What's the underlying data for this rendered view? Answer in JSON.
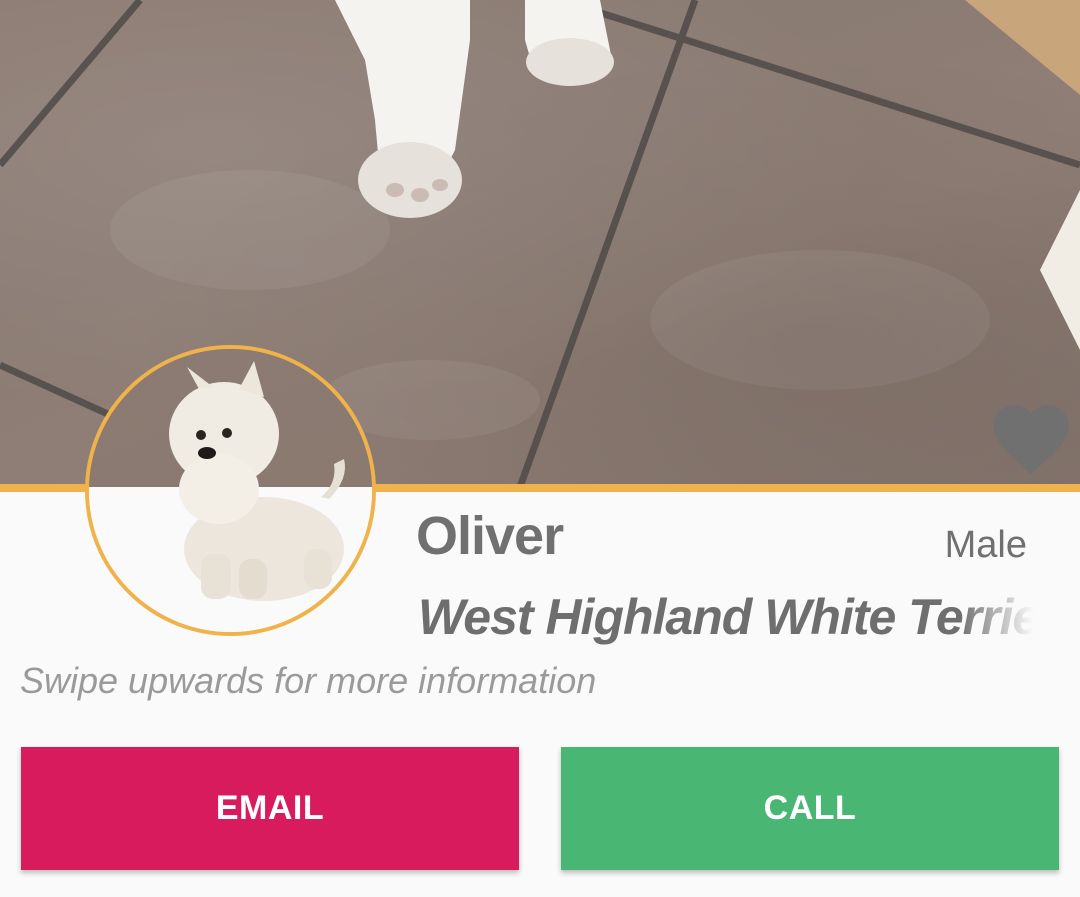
{
  "pet": {
    "name": "Oliver",
    "gender": "Male",
    "breed": "West Highland White Terrier"
  },
  "hint": "Swipe upwards for more information",
  "actions": {
    "email_label": "EMAIL",
    "call_label": "CALL"
  },
  "colors": {
    "accent": "#f0b24a",
    "email": "#d81b5c",
    "call": "#4ab674",
    "text": "#707070",
    "heart": "#707070"
  },
  "icons": {
    "favorite": "heart-icon"
  }
}
